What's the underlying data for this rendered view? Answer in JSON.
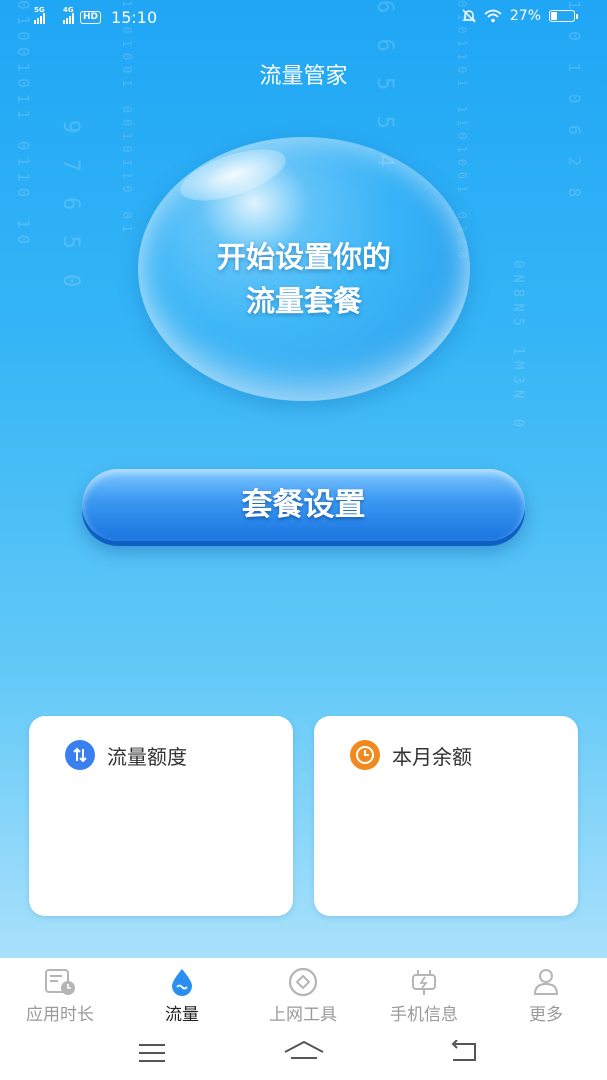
{
  "status_bar": {
    "network_1": "5G",
    "network_2": "4G",
    "hd": "HD",
    "time": "15:10",
    "battery": "27%",
    "battery_level": 0.27
  },
  "header": {
    "title": "流量管家"
  },
  "hero": {
    "line1": "开始设置你的",
    "line2": "流量套餐"
  },
  "package_button": {
    "label": "套餐设置"
  },
  "cards": [
    {
      "label": "流量额度",
      "icon": "traffic-quota-icon",
      "color": "#3a7ff0"
    },
    {
      "label": "本月余额",
      "icon": "clock-icon",
      "color": "#f08a1f"
    }
  ],
  "tabs": [
    {
      "label": "应用时长",
      "icon": "app-usage-icon",
      "active": false
    },
    {
      "label": "流量",
      "icon": "water-drop-icon",
      "active": true
    },
    {
      "label": "上网工具",
      "icon": "network-tools-icon",
      "active": false
    },
    {
      "label": "手机信息",
      "icon": "phone-info-icon",
      "active": false
    },
    {
      "label": "更多",
      "icon": "more-icon",
      "active": false
    }
  ],
  "colors": {
    "accent": "#1f9cf0",
    "active_tab": "#222222",
    "inactive_tab": "#9a9a9a"
  }
}
